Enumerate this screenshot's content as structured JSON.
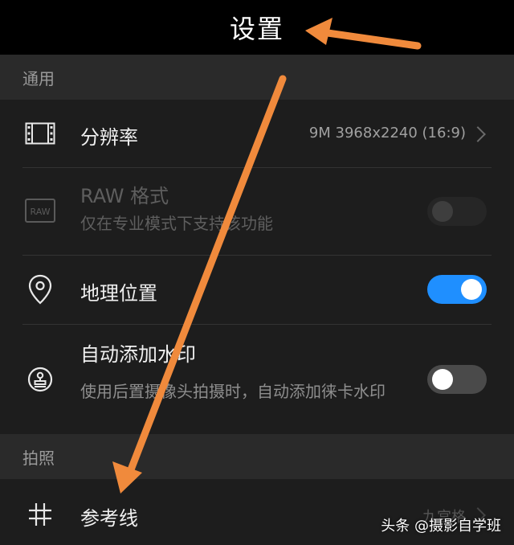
{
  "header": {
    "title": "设置"
  },
  "sections": {
    "general": "通用",
    "photo": "拍照"
  },
  "resolution": {
    "label": "分辨率",
    "value": "9M 3968x2240 (16:9)",
    "icon": "film-frame-icon"
  },
  "raw": {
    "label": "RAW 格式",
    "sub": "仅在专业模式下支持该功能",
    "icon_text": "RAW",
    "enabled": false,
    "state": "disabled"
  },
  "location": {
    "label": "地理位置",
    "state": "on",
    "icon": "location-pin-icon"
  },
  "watermark_setting": {
    "label": "自动添加水印",
    "sub": "使用后置摄像头拍摄时，自动添加徕卡水印",
    "state": "off",
    "icon": "stamp-icon"
  },
  "gridlines": {
    "label": "参考线",
    "value": "九宫格",
    "icon": "grid-icon"
  },
  "overlay": {
    "watermark": "头条 @摄影自学班",
    "arrow_color": "#f08a3c"
  }
}
